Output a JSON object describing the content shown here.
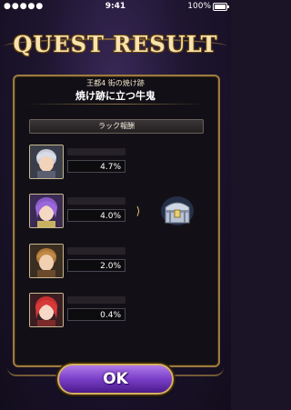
{
  "status_bar": {
    "signal": "●●●●●",
    "time": "9:41",
    "battery_pct": "100%"
  },
  "screen": {
    "title": "QUEST RESULT"
  },
  "quest": {
    "subtitle": "王都4 街の焼け跡",
    "name": "焼け跡に立つ牛鬼"
  },
  "section": {
    "label": "ラック報酬"
  },
  "party": [
    {
      "percent": "4.7%"
    },
    {
      "percent": "4.0%"
    },
    {
      "percent": "2.0%"
    },
    {
      "percent": "0.4%"
    }
  ],
  "reward": {
    "arrow_glyph": "⟩",
    "chest_icon": "treasure-chest-icon"
  },
  "ok_button": {
    "label": "OK"
  }
}
